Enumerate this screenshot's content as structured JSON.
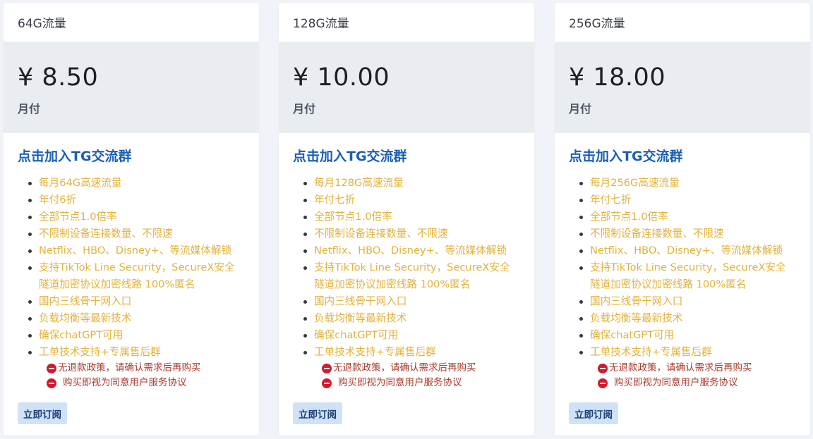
{
  "plans": [
    {
      "title": "64G流量",
      "price": "¥ 8.50",
      "period": "月付",
      "tg_link": "点击加入TG交流群",
      "features": [
        "每月64G高速流量",
        "年付6折",
        "全部节点1.0倍率",
        "不限制设备连接数量、不限速",
        "Netflix、HBO、Disney+、等流媒体解锁",
        "支持TikTok Line Security，SecureX安全隧道加密协议加密线路 100%匿名",
        "国内三线骨干网入口",
        "负载均衡等最新技术",
        "确保chatGPT可用",
        "工单技术支持+专属售后群"
      ],
      "notices": [
        "无退款政策，请确认需求后再购买",
        "购买即视为同意用户服务协议"
      ],
      "button": "立即订阅"
    },
    {
      "title": "128G流量",
      "price": "¥ 10.00",
      "period": "月付",
      "tg_link": "点击加入TG交流群",
      "features": [
        "每月128G高速流量",
        "年付七折",
        "全部节点1.0倍率",
        "不限制设备连接数量、不限速",
        "Netflix、HBO、Disney+、等流媒体解锁",
        "支持TikTok Line Security，SecureX安全隧道加密协议加密线路 100%匿名",
        "国内三线骨干网入口",
        "负载均衡等最新技术",
        "确保chatGPT可用",
        "工单技术支持+专属售后群"
      ],
      "notices": [
        "无退款政策，请确认需求后再购买",
        "购买即视为同意用户服务协议"
      ],
      "button": "立即订阅"
    },
    {
      "title": "256G流量",
      "price": "¥ 18.00",
      "period": "月付",
      "tg_link": "点击加入TG交流群",
      "features": [
        "每月256G高速流量",
        "年付七折",
        "全部节点1.0倍率",
        "不限制设备连接数量、不限速",
        "Netflix、HBO、Disney+、等流媒体解锁",
        "支持TikTok Line Security，SecureX安全隧道加密协议加密线路 100%匿名",
        "国内三线骨干网入口",
        "负载均衡等最新技术",
        "确保chatGPT可用",
        "工单技术支持+专属售后群"
      ],
      "notices": [
        "无退款政策，请确认需求后再购买",
        "购买即视为同意用户服务协议"
      ],
      "button": "立即订阅"
    }
  ],
  "icons": {
    "notice": "no-entry-icon"
  },
  "colors": {
    "link": "#1a5fb4",
    "feature": "#e0b23c",
    "notice": "#a83a2c",
    "stop": "#d3192b",
    "button_bg": "#cfe2f7"
  }
}
